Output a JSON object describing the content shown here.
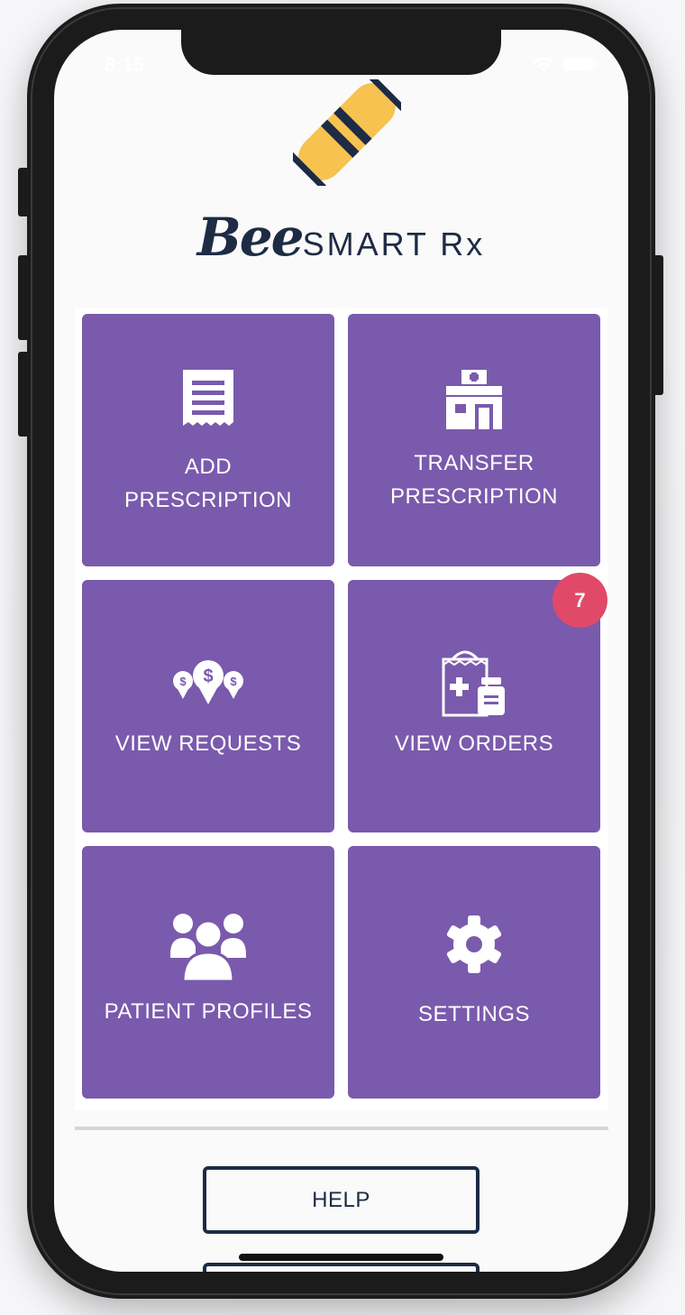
{
  "status_bar": {
    "time": "8:15"
  },
  "brand": {
    "prefix": "Bee",
    "suffix": "SMART Rx"
  },
  "tiles": [
    {
      "label": "ADD\nPRESCRIPTION",
      "icon": "receipt-icon"
    },
    {
      "label": "TRANSFER\nPRESCRIPTION",
      "icon": "pharmacy-building-icon"
    },
    {
      "label": "VIEW REQUESTS",
      "icon": "money-pins-icon"
    },
    {
      "label": "VIEW ORDERS",
      "icon": "medicine-bag-icon",
      "badge": "7"
    },
    {
      "label": "PATIENT PROFILES",
      "icon": "users-group-icon"
    },
    {
      "label": "SETTINGS",
      "icon": "gear-icon"
    }
  ],
  "help_label": "HELP",
  "colors": {
    "tile": "#7a5aac",
    "badge": "#e04a68",
    "navy": "#1e2b45",
    "logo_yellow": "#f6c350"
  }
}
